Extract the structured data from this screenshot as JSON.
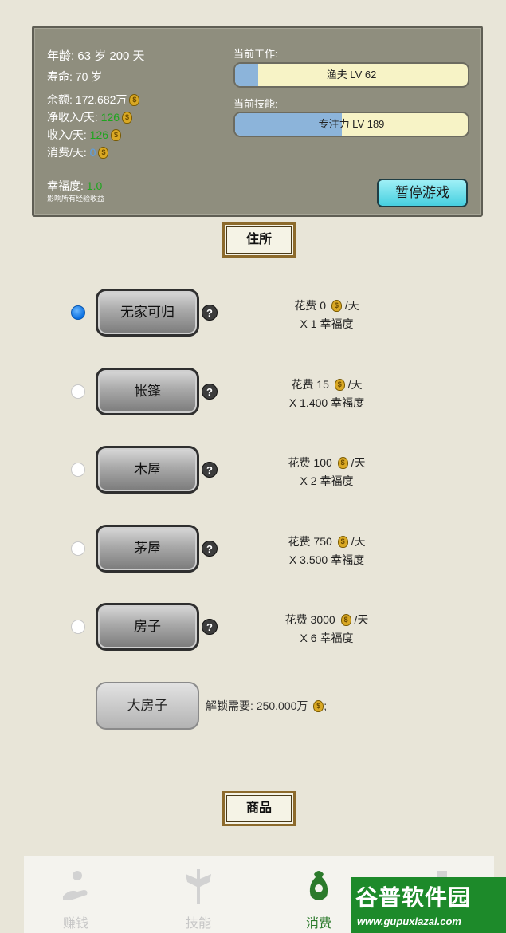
{
  "status": {
    "age": "年龄: 63 岁 200 天",
    "lifespan": "寿命: 70 岁",
    "balance_label": "余额: ",
    "balance_value": "172.682万",
    "net_income_label": "净收入/天: ",
    "net_income_value": "126",
    "income_label": "收入/天: ",
    "income_value": "126",
    "expense_label": "消费/天: ",
    "expense_value": "0",
    "happiness_label": "幸福度: ",
    "happiness_value": "1.0",
    "happiness_note": "影响所有经验收益",
    "job_label": "当前工作:",
    "job_value": "渔夫 LV 62",
    "job_progress": 0.1,
    "skill_label": "当前技能:",
    "skill_value": "专注力 LV 189",
    "skill_progress": 0.46,
    "pause_button": "暂停游戏"
  },
  "housing": {
    "title": "住所",
    "items": [
      {
        "label": "无家可归",
        "selected": true,
        "cost_line1": "花费 0",
        "cost_unit": "/天",
        "cost_line2": "X 1 幸福度"
      },
      {
        "label": "帐篷",
        "selected": false,
        "cost_line1": "花费 15",
        "cost_unit": "/天",
        "cost_line2": "X 1.400 幸福度"
      },
      {
        "label": "木屋",
        "selected": false,
        "cost_line1": "花费 100",
        "cost_unit": "/天",
        "cost_line2": "X 2 幸福度"
      },
      {
        "label": "茅屋",
        "selected": false,
        "cost_line1": "花费 750",
        "cost_unit": "/天",
        "cost_line2": "X 3.500 幸福度"
      },
      {
        "label": "房子",
        "selected": false,
        "cost_line1": "花费 3000",
        "cost_unit": "/天",
        "cost_line2": "X 6 幸福度"
      }
    ],
    "locked": {
      "label": "大房子",
      "unlock_text": "解锁需要: 250.000万",
      "unlock_suffix": ";"
    }
  },
  "goods": {
    "title": "商品"
  },
  "tabs": [
    {
      "label": "赚钱",
      "icon": "money-hand-icon",
      "active": false
    },
    {
      "label": "技能",
      "icon": "winged-sword-icon",
      "active": false
    },
    {
      "label": "消费",
      "icon": "coin-bag-icon",
      "active": true
    },
    {
      "label": "",
      "icon": "other-icon",
      "active": false
    }
  ],
  "watermark": {
    "line1": "谷普软件园",
    "line2": "www.gupuxiazai.com"
  }
}
